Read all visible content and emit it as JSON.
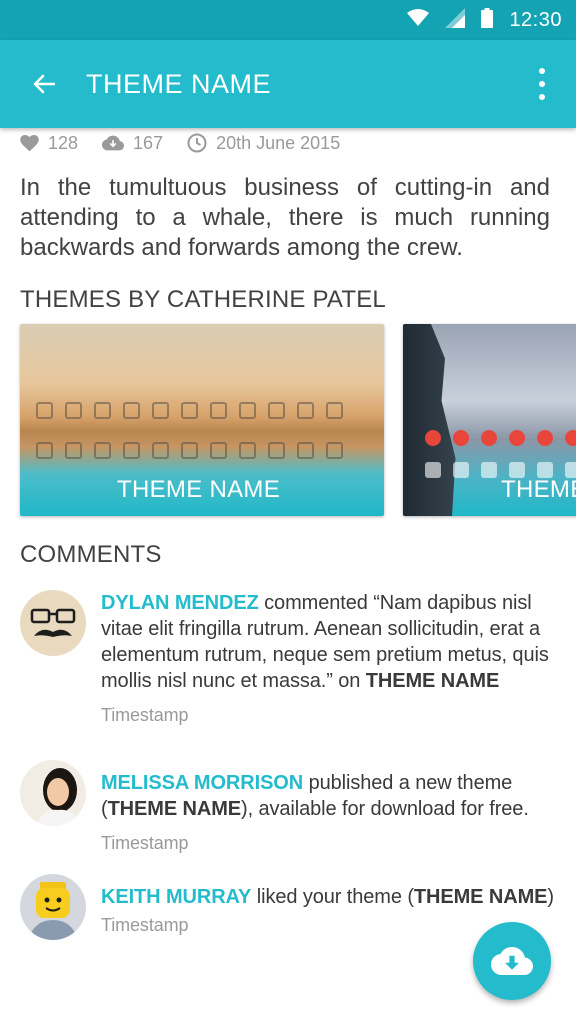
{
  "status_bar": {
    "time": "12:30"
  },
  "app_bar": {
    "title": "THEME NAME"
  },
  "stats": {
    "likes": "128",
    "downloads": "167",
    "date": "20th June 2015"
  },
  "description": "In the tumultuous business of cutting-in and attending to a whale, there is much running backwards and forwards among the crew.",
  "themes_section": {
    "title": "THEMES BY CATHERINE PATEL",
    "cards": [
      {
        "label": "THEME NAME"
      },
      {
        "label": "THEME NAME"
      }
    ]
  },
  "comments_section": {
    "title": "COMMENTS",
    "items": [
      {
        "name": "DYLAN MENDEZ",
        "action": " commented “Nam dapibus nisl vitae elit fringilla rutrum. Aenean sollicitudin, erat a elementum rutrum, neque sem pretium metus, quis mollis nisl nunc et massa.” on ",
        "theme": "THEME NAME",
        "suffix": "",
        "timestamp": "Timestamp"
      },
      {
        "name": "MELISSA MORRISON",
        "action": " published a new theme (",
        "theme": "THEME NAME",
        "suffix": "), available for download for free.",
        "timestamp": "Timestamp"
      },
      {
        "name": "KEITH MURRAY",
        "action": " liked your theme (",
        "theme": "THEME NAME",
        "suffix": ")",
        "timestamp": "Timestamp"
      }
    ]
  },
  "colors": {
    "primary": "#24bccd",
    "status_bar": "#14a3b2"
  },
  "icons": [
    "wifi-icon",
    "signal-icon",
    "battery-icon",
    "back-arrow-icon",
    "more-vert-icon",
    "heart-icon",
    "cloud-download-icon",
    "clock-icon",
    "download-fab-icon"
  ]
}
